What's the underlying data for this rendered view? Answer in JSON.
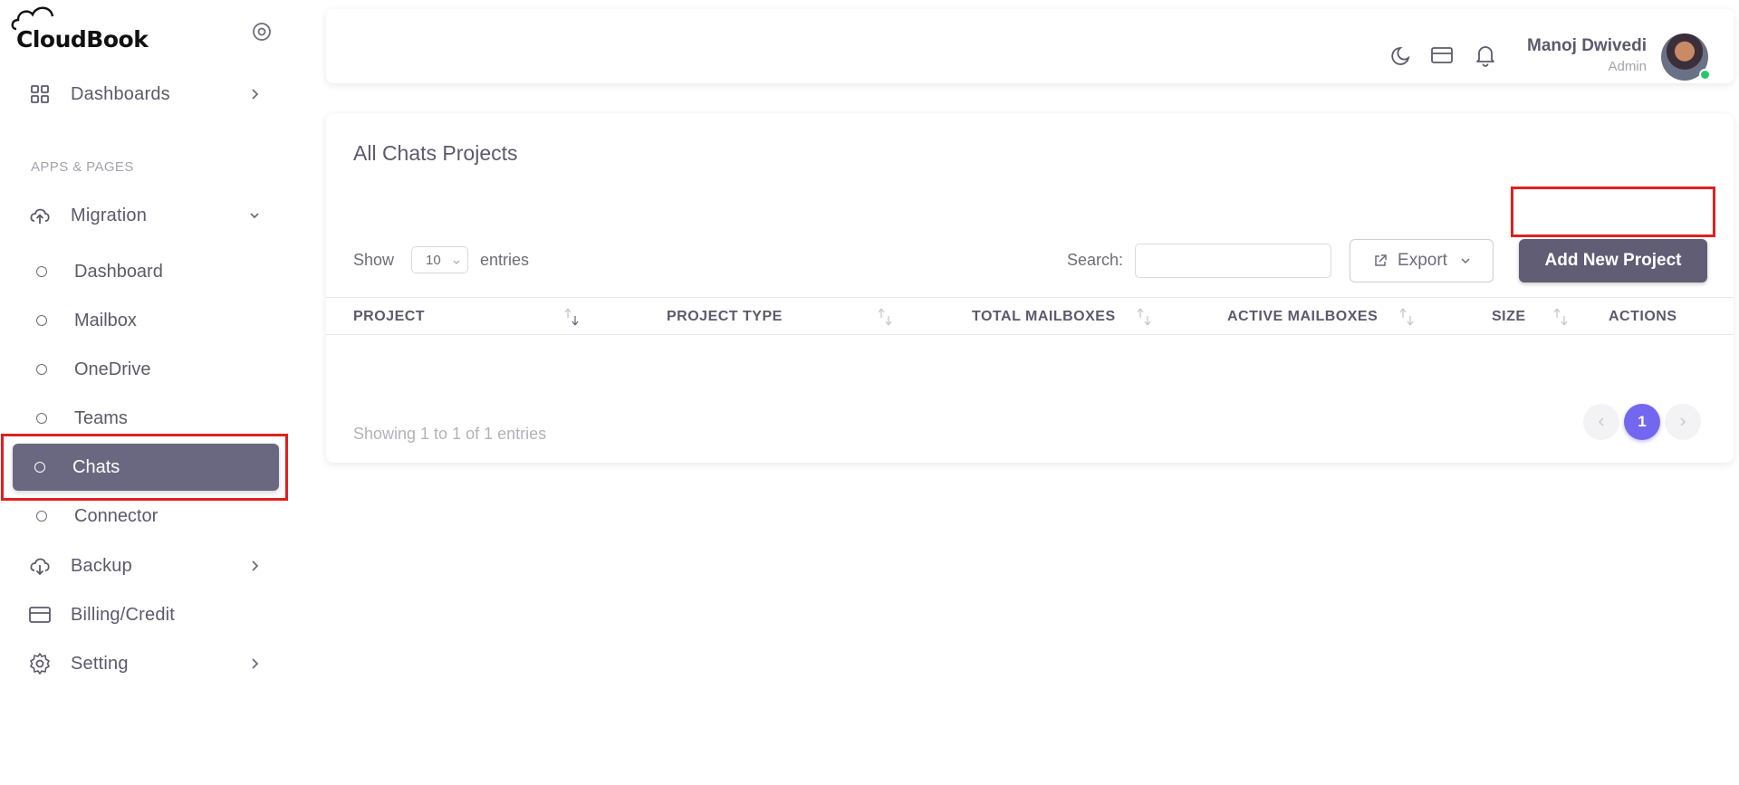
{
  "brand": {
    "name": "CloudBook"
  },
  "sidebar": {
    "dashboards_label": "Dashboards",
    "section_title": "APPS & PAGES",
    "migration_label": "Migration",
    "sub_items": [
      "Dashboard",
      "Mailbox",
      "OneDrive",
      "Teams",
      "Chats",
      "Connector"
    ],
    "active_sub_item": "Chats",
    "backup_label": "Backup",
    "billing_label": "Billing/Credit",
    "setting_label": "Setting"
  },
  "navbar": {
    "user_name": "Manoj Dwivedi",
    "user_role": "Admin",
    "icons": [
      "moon-icon",
      "credit-card-icon",
      "bell-icon"
    ]
  },
  "main": {
    "title": "All Chats Projects",
    "show_label": "Show",
    "entries_value": "10",
    "entries_label": "entries",
    "search_label": "Search:",
    "search_value": "",
    "export_label": "Export",
    "add_button_label": "Add New Project",
    "columns": [
      "PROJECT",
      "PROJECT TYPE",
      "TOTAL MAILBOXES",
      "ACTIVE MAILBOXES",
      "SIZE",
      "ACTIONS"
    ],
    "rows": [],
    "showing_text": "Showing 1 to 1 of 1 entries",
    "current_page": "1"
  },
  "colors": {
    "active_sidebar": "#6a6880",
    "primary_button": "#605d74",
    "page_active": "#7367f0",
    "highlight": "#e02020",
    "status_online": "#28c76f"
  }
}
